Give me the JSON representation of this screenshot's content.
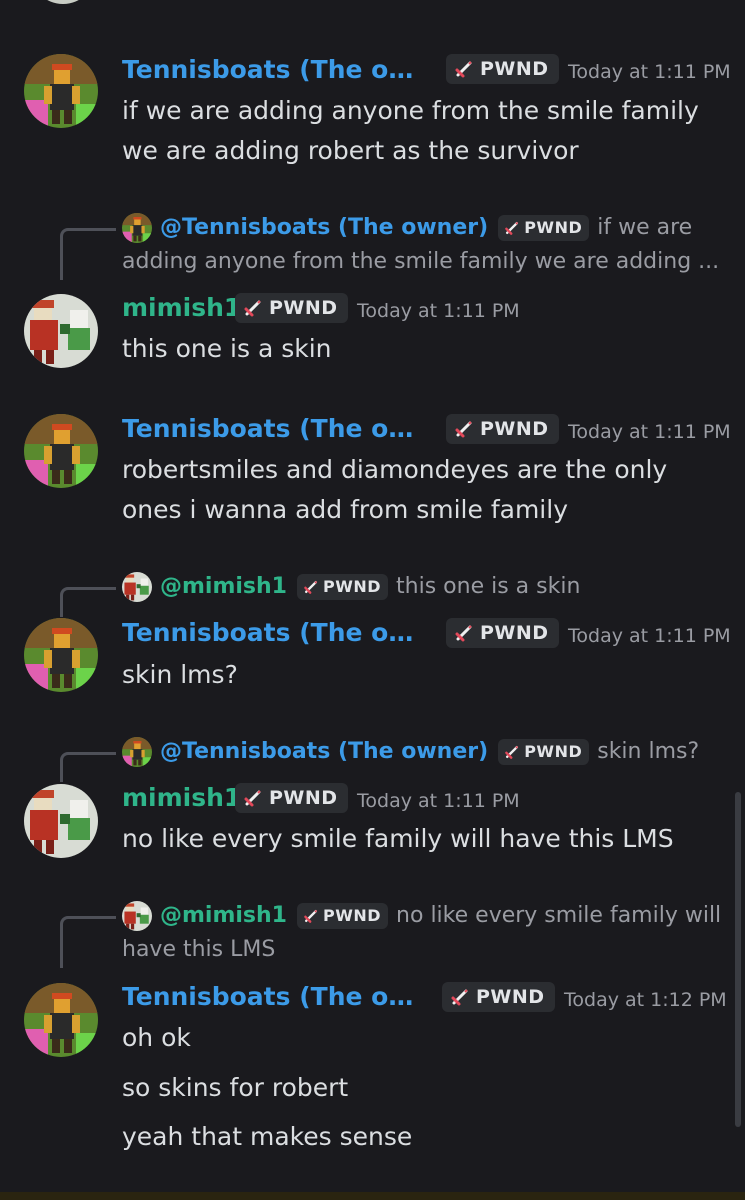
{
  "colors": {
    "background": "#1a1a1e",
    "tennisboats_name": "#3c9be8",
    "mimish_name": "#2fb58a",
    "timestamp": "#9a9ca3",
    "badge_bg": "#2b2d31"
  },
  "badge_label": "PWND",
  "messages": [
    {
      "author": "Tennisboats (The own...",
      "time": "Today at 1:11 PM",
      "lines": [
        "if we are adding anyone from the smile family",
        "we are adding robert as the survivor"
      ]
    },
    {
      "author": "mimish1",
      "time": "Today at 1:11 PM",
      "reply": {
        "author": "@Tennisboats (The owner)",
        "text1": "if we are",
        "text2": "adding anyone from the smile family we are adding ..."
      },
      "lines": [
        "this one is a skin"
      ]
    },
    {
      "author": "Tennisboats (The own...",
      "time": "Today at 1:11 PM",
      "lines": [
        "robertsmiles and diamondeyes are the only",
        "ones i wanna add from smile family"
      ]
    },
    {
      "author": "Tennisboats (The own...",
      "time": "Today at 1:11 PM",
      "reply": {
        "author": "@mimish1",
        "text1": "this one is a skin"
      },
      "lines": [
        "skin lms?"
      ]
    },
    {
      "author": "mimish1",
      "time": "Today at 1:11 PM",
      "reply": {
        "author": "@Tennisboats (The owner)",
        "text1": "skin lms?"
      },
      "lines": [
        "no like  every smile family will have this LMS"
      ]
    },
    {
      "author": "Tennisboats (The own...",
      "time": "Today at 1:12 PM",
      "reply": {
        "author": "@mimish1",
        "text1": "no like  every smile family will",
        "text2": "have this LMS"
      },
      "lines": [
        "oh ok",
        "so skins for robert",
        "yeah that makes sense"
      ]
    }
  ],
  "icons": {
    "avatar_tennisboats": "roblox-avatar-icon",
    "avatar_mimish": "roblox-avatar-icon",
    "badge": "sword-icon"
  }
}
